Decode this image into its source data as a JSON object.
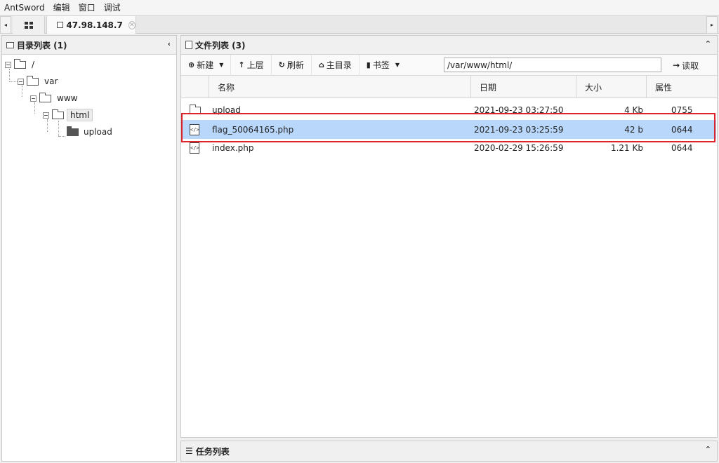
{
  "menu": [
    "AntSword",
    "编辑",
    "窗口",
    "调试"
  ],
  "tabs": {
    "active_label": "47.98.148.7",
    "home_icon": "grid-icon",
    "left_arrow": "◂",
    "right_arrow": "▸"
  },
  "dir_panel": {
    "title": "目录列表 (1)",
    "tree": [
      {
        "label": "/",
        "depth": 0
      },
      {
        "label": "var",
        "depth": 1
      },
      {
        "label": "www",
        "depth": 2
      },
      {
        "label": "html",
        "depth": 3
      },
      {
        "label": "upload",
        "depth": 4
      }
    ]
  },
  "file_panel": {
    "title": "文件列表 (3)",
    "toolbar": {
      "new": "新建",
      "up": "上层",
      "refresh": "刷新",
      "home": "主目录",
      "bookmark": "书签",
      "path_value": "/var/www/html/",
      "read": "读取"
    },
    "columns": [
      "名称",
      "日期",
      "大小",
      "属性"
    ],
    "rows": [
      {
        "name": "upload",
        "date": "2021-09-23 03:27:50",
        "size": "4 Kb",
        "perm": "0755",
        "type": "folder"
      },
      {
        "name": "flag_50064165.php",
        "date": "2021-09-23 03:25:59",
        "size": "42 b",
        "perm": "0644",
        "type": "php"
      },
      {
        "name": "index.php",
        "date": "2020-02-29 15:26:59",
        "size": "1.21 Kb",
        "perm": "0644",
        "type": "php"
      }
    ]
  },
  "task_panel": {
    "title": "任务列表"
  },
  "colors": {
    "selected_row": "#b8d7fb",
    "highlight_border": "#d9252b"
  }
}
